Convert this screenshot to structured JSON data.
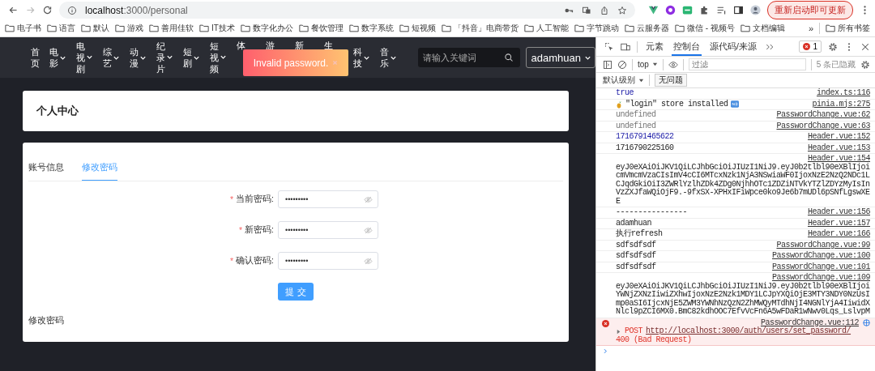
{
  "browser": {
    "url_host": "localhost",
    "url_path": ":3000/personal",
    "update_button": "重新启动即可更新"
  },
  "bookmarks": [
    {
      "label": "电子书"
    },
    {
      "label": "语言"
    },
    {
      "label": "默认"
    },
    {
      "label": "游戏"
    },
    {
      "label": "善用佳软"
    },
    {
      "label": "IT技术"
    },
    {
      "label": "数字化办公"
    },
    {
      "label": "餐饮管理"
    },
    {
      "label": "数字系统"
    },
    {
      "label": "短视频"
    },
    {
      "label": "「抖音」电商带货"
    },
    {
      "label": "人工智能"
    },
    {
      "label": "字节跳动"
    },
    {
      "label": "云服务器"
    },
    {
      "label": "微信 - 视频号"
    },
    {
      "label": "文档编辑"
    }
  ],
  "bookmarks_more": "»",
  "all_bookmarks": "所有书签",
  "header": {
    "nav": [
      {
        "label": "首页",
        "has_menu": false,
        "clipped": false
      },
      {
        "label": "电影",
        "has_menu": true,
        "clipped": false
      },
      {
        "label": "电视剧",
        "has_menu": true,
        "clipped": false
      },
      {
        "label": "综艺",
        "has_menu": true,
        "clipped": false
      },
      {
        "label": "动漫",
        "has_menu": true,
        "clipped": false
      },
      {
        "label": "纪录片",
        "has_menu": true,
        "clipped": false
      },
      {
        "label": "短剧",
        "has_menu": true,
        "clipped": false
      },
      {
        "label": "短视频",
        "has_menu": true,
        "clipped": false
      },
      {
        "label": "体",
        "has_menu": false,
        "clipped": true
      },
      {
        "label": "游",
        "has_menu": false,
        "clipped": true
      },
      {
        "label": "新",
        "has_menu": false,
        "clipped": true
      },
      {
        "label": "生",
        "has_menu": false,
        "clipped": true
      },
      {
        "label": "科技",
        "has_menu": true,
        "clipped": false
      },
      {
        "label": "音乐",
        "has_menu": true,
        "clipped": false
      }
    ],
    "search": {
      "placeholder": "请输入关键词"
    },
    "user": "adamhuan",
    "toast": "Invalid password."
  },
  "profile_card": {
    "title": "个人中心"
  },
  "tabs": [
    {
      "label": "账号信息",
      "selected": false
    },
    {
      "label": "修改密码",
      "selected": true
    }
  ],
  "form": {
    "required_mark": "*",
    "fields": [
      {
        "label": "当前密码:",
        "required": true,
        "value": "•••••••••"
      },
      {
        "label": "新密码:",
        "required": true,
        "value": "•••••••••"
      },
      {
        "label": "确认密码:",
        "required": true,
        "value": "•••••••••"
      }
    ],
    "submit": "提 交"
  },
  "footer_text": "修改密码",
  "devtools": {
    "tabs": [
      {
        "label": "元素",
        "selected": false
      },
      {
        "label": "控制台",
        "selected": true
      },
      {
        "label": "源代码/来源",
        "selected": false
      }
    ],
    "error_count": "1",
    "context": "top",
    "filter_placeholder": "过滤",
    "hidden": "5 条已隐藏",
    "level": "默认级别",
    "issues": "无问题",
    "messages": [
      {
        "kind": "boolean",
        "text": "true",
        "source": "index.ts:116"
      },
      {
        "kind": "pinia",
        "text": "\"login\" store installed",
        "source": "pinia.mjs:275"
      },
      {
        "kind": "undefined",
        "text": "undefined",
        "source": "PasswordChange.vue:62"
      },
      {
        "kind": "undefined",
        "text": "undefined",
        "source": "PasswordChange.vue:63"
      },
      {
        "kind": "number",
        "text": "1716791465622",
        "source": "Header.vue:152"
      },
      {
        "kind": "string",
        "text": "1716790225160",
        "source": "Header.vue:153"
      },
      {
        "kind": "token",
        "text": "eyJ0eXAiOiJKV1QiLCJhbGciOiJIUzI1NiJ9.eyJ0b2tlbl90eXBlIjoicmVmcmVzaCIsImV4cCI6MTcxNzk1NjA3NSwiaWF0IjoxNzE2NzQ2NDc1LCJqdGkiOiI3ZWRlYzlhZDk4ZDg0NjhhOTc1ZDZiNTVkYTZlZDYzMyIsInVzZXJfaWQiOjF9.-9fxSX-XPHxIFiWpce0ko9Je6b7mUDl6pSNfLgswXEE",
        "source": "Header.vue:154"
      },
      {
        "kind": "string",
        "text": "----------------",
        "source": "Header.vue:156"
      },
      {
        "kind": "string",
        "text": "adamhuan",
        "source": "Header.vue:157"
      },
      {
        "kind": "string",
        "text": "执行refresh",
        "source": "Header.vue:166"
      },
      {
        "kind": "string",
        "text": "sdfsdfsdf",
        "source": "PasswordChange.vue:99"
      },
      {
        "kind": "string",
        "text": "sdfsdfsdf",
        "source": "PasswordChange.vue:100"
      },
      {
        "kind": "string",
        "text": "sdfsdfsdf",
        "source": "PasswordChange.vue:101"
      },
      {
        "kind": "token",
        "text": "eyJ0eXAiOiJKV1QiLCJhbGciOiJIUzI1NiJ9.eyJ0b2tlbl90eXBlIjoiYWNjZXNzIiwiZXhwIjoxNzE2Nzk1MDY1LCJpYXQiOjE3MTY3NDY0NzUsImp0aSI6IjcxNjE5ZWM3YWNhNzQzN2ZhMWQyMTdhNjI4NGNlYjA4IiwidXNlcl9pZCI6MX0.BmC82kdhOOC7EfvVcFn6A5wFDaR1wNwv0Lqs_LslvpM",
        "source": "PasswordChange.vue:109"
      },
      {
        "kind": "error",
        "method": "POST",
        "url": "http://localhost:3000/auth/users/set_password/",
        "status": "400 (Bad Request)",
        "source": "PasswordChange.vue:112"
      }
    ]
  }
}
